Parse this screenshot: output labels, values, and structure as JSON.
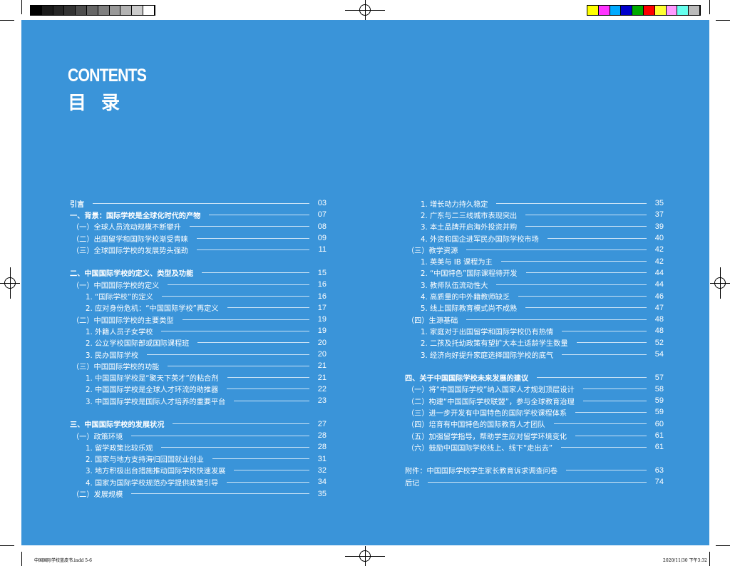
{
  "header": {
    "title_en": "CONTENTS",
    "title_zh": "目 录"
  },
  "colors": {
    "background": "#3a94d9",
    "gray_bars": [
      "#000000",
      "#1a1a1a",
      "#262626",
      "#333333",
      "#4d4d4d",
      "#666666",
      "#808080",
      "#999999",
      "#b3b3b3",
      "#cccccc",
      "#ffffff"
    ],
    "color_bars": [
      "#ffff00",
      "#ff33ff",
      "#00aaff",
      "#0000cc",
      "#00aa00",
      "#ff0000",
      "#ffff33",
      "#ff99ff",
      "#66ffee",
      "#bbbbbb"
    ]
  },
  "toc_left": [
    {
      "label": "引言",
      "page": "03",
      "level": 0
    },
    {
      "label": "一、背景：国际学校是全球化时代的产物",
      "page": "07",
      "level": 0
    },
    {
      "label": "（一）全球人员流动规模不断攀升",
      "page": "08",
      "level": 1
    },
    {
      "label": "（二）出国留学和国际学校渐受青睐",
      "page": "09",
      "level": 1
    },
    {
      "label": "（三）全球国际学校的发展势头强劲",
      "page": "11",
      "level": 1
    },
    {
      "gap": true
    },
    {
      "label": "二、中国国际学校的定义、类型及功能",
      "page": "15",
      "level": 0
    },
    {
      "label": "（一）中国国际学校的定义",
      "page": "16",
      "level": 1
    },
    {
      "label": "1. “国际学校”的定义",
      "page": "16",
      "level": 2
    },
    {
      "label": "2. 应对身份危机：“中国国际学校”再定义",
      "page": "17",
      "level": 2
    },
    {
      "label": "（二）中国国际学校的主要类型",
      "page": "19",
      "level": 1
    },
    {
      "label": "1. 外籍人员子女学校",
      "page": "19",
      "level": 2
    },
    {
      "label": "2. 公立学校国际部或国际课程班",
      "page": "20",
      "level": 2
    },
    {
      "label": "3. 民办国际学校",
      "page": "20",
      "level": 2
    },
    {
      "label": "（三）中国国际学校的功能",
      "page": "21",
      "level": 1
    },
    {
      "label": "1. 中国国际学校是“聚天下英才”的粘合剂",
      "page": "21",
      "level": 2
    },
    {
      "label": "2. 中国国际学校是全球人才环流的助推器",
      "page": "22",
      "level": 2
    },
    {
      "label": "3. 中国国际学校是国际人才培养的重要平台",
      "page": "23",
      "level": 2
    },
    {
      "gap": true
    },
    {
      "label": "三、中国国际学校的发展状况",
      "page": "27",
      "level": 0
    },
    {
      "label": "（一）政策环境",
      "page": "28",
      "level": 1
    },
    {
      "label": "1. 留学政策比较乐观",
      "page": "28",
      "level": 2
    },
    {
      "label": "2. 国家与地方支持海归回国就业创业",
      "page": "31",
      "level": 2
    },
    {
      "label": "3. 地方积极出台措施推动国际学校快速发展",
      "page": "32",
      "level": 2
    },
    {
      "label": "4. 国家为国际学校规范办学提供政策引导",
      "page": "34",
      "level": 2
    },
    {
      "label": "（二）发展规模",
      "page": "35",
      "level": 1
    }
  ],
  "toc_right": [
    {
      "label": "1. 增长动力持久稳定",
      "page": "35",
      "level": 2
    },
    {
      "label": "2. 广东与二三线城市表现突出",
      "page": "37",
      "level": 2
    },
    {
      "label": "3. 本土品牌开启海外投资并购",
      "page": "39",
      "level": 2
    },
    {
      "label": "4. 外资和国企进军民办国际学校市场",
      "page": "40",
      "level": 2
    },
    {
      "label": "（三）教学资源",
      "page": "42",
      "level": 1
    },
    {
      "label": "1. 英美与 IB 课程为主",
      "page": "42",
      "level": 2
    },
    {
      "label": "2. “中国特色”国际课程待开发",
      "page": "44",
      "level": 2
    },
    {
      "label": "3. 教师队伍流动性大",
      "page": "44",
      "level": 2
    },
    {
      "label": "4. 高质量的中外籍教师缺乏",
      "page": "46",
      "level": 2
    },
    {
      "label": "5. 线上国际教育模式尚不成熟",
      "page": "47",
      "level": 2
    },
    {
      "label": "（四）生源基础",
      "page": "48",
      "level": 1
    },
    {
      "label": "1. 家庭对于出国留学和国际学校仍有热情",
      "page": "48",
      "level": 2
    },
    {
      "label": "2. 二孩及托幼政策有望扩大本土适龄学生数量",
      "page": "52",
      "level": 2
    },
    {
      "label": "3. 经济向好提升家庭选择国际学校的底气",
      "page": "54",
      "level": 2
    },
    {
      "gap": true
    },
    {
      "label": "四、关于中国国际学校未来发展的建议",
      "page": "57",
      "level": 0
    },
    {
      "label": "（一）将“中国国际学校”纳入国家人才规划顶层设计",
      "page": "58",
      "level": 1
    },
    {
      "label": "（二）构建“中国国际学校联盟”，参与全球教育治理",
      "page": "59",
      "level": 1
    },
    {
      "label": "（三）进一步开发有中国特色的国际学校课程体系",
      "page": "59",
      "level": 1
    },
    {
      "label": "（四）培育有中国特色的国际教育人才团队",
      "page": "60",
      "level": 1
    },
    {
      "label": "（五）加强留学指导，帮助学生应对留学环境变化",
      "page": "61",
      "level": 1
    },
    {
      "label": "（六）鼓励中国国际学校线上、线下“走出去”",
      "page": "61",
      "level": 1
    },
    {
      "gap": true
    },
    {
      "label": "附件：中国国际学校学生家长教育诉求调查问卷",
      "page": "63",
      "level": 3
    },
    {
      "label": "后记",
      "page": "74",
      "level": 3
    }
  ],
  "footer": {
    "file": "中国国际学校蓝皮书.indd   5-6",
    "timestamp": "2020/11/30   下午3:32"
  }
}
